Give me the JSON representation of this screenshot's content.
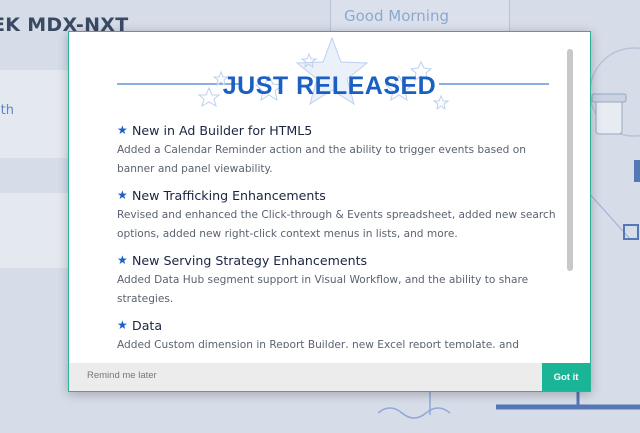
{
  "background": {
    "title": "EK MDX-NXT",
    "panel_link": "ith",
    "greeting": "Good Morning"
  },
  "modal": {
    "title": "JUST RELEASED",
    "items": [
      {
        "title": "New in Ad Builder for HTML5",
        "description": "Added a Calendar Reminder action and the ability to trigger events based on banner and panel viewability."
      },
      {
        "title": "New Trafficking Enhancements",
        "description": "Revised and enhanced the Click-through & Events spreadsheet, added new search options, added new right-click context menus in lists, and more."
      },
      {
        "title": "New Serving Strategy Enhancements",
        "description": "Added Data Hub segment support in Visual Workflow, and the ability to share strategies."
      },
      {
        "title": "Data",
        "description": "Added Custom dimension in Report Builder, new Excel report template, and updated STR"
      }
    ],
    "footer": {
      "remind_label": "Remind me later",
      "got_it_label": "Got it"
    }
  },
  "colors": {
    "accent": "#1ab596",
    "title_blue": "#1a5fc4"
  }
}
